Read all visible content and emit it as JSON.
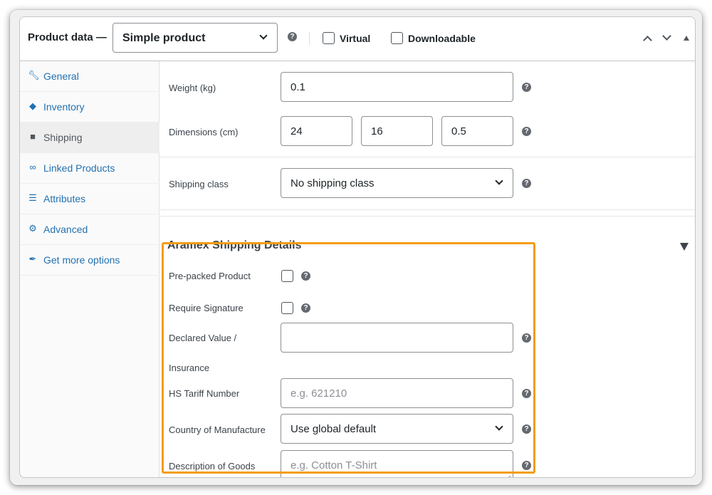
{
  "header": {
    "title": "Product data —",
    "product_type": "Simple product",
    "virtual_label": "Virtual",
    "downloadable_label": "Downloadable"
  },
  "sidebar": {
    "items": [
      {
        "label": "General",
        "icon": "wrench-icon"
      },
      {
        "label": "Inventory",
        "icon": "tag-icon"
      },
      {
        "label": "Shipping",
        "icon": "truck-icon",
        "active": true
      },
      {
        "label": "Linked Products",
        "icon": "link-icon"
      },
      {
        "label": "Attributes",
        "icon": "list-icon"
      },
      {
        "label": "Advanced",
        "icon": "gear-icon"
      },
      {
        "label": "Get more options",
        "icon": "plugin-icon"
      }
    ]
  },
  "shipping": {
    "weight_label": "Weight (kg)",
    "weight_value": "0.1",
    "dimensions_label": "Dimensions (cm)",
    "length": "24",
    "width": "16",
    "height": "0.5",
    "class_label": "Shipping class",
    "class_value": "No shipping class"
  },
  "aramex": {
    "title": "Aramex Shipping Details",
    "prepacked_label": "Pre-packed Product",
    "signature_label": "Require Signature",
    "declared_label_1": "Declared Value /",
    "declared_label_2": "Insurance",
    "declared_value": "",
    "hs_label": "HS Tariff Number",
    "hs_placeholder": "e.g. 621210",
    "country_label": "Country of Manufacture",
    "country_value": "Use global default",
    "description_label": "Description of Goods",
    "description_placeholder": "e.g. Cotton T-Shirt"
  },
  "icons": {
    "help": "?"
  },
  "colors": {
    "accent": "#2271b1",
    "highlight": "#f39c12"
  }
}
